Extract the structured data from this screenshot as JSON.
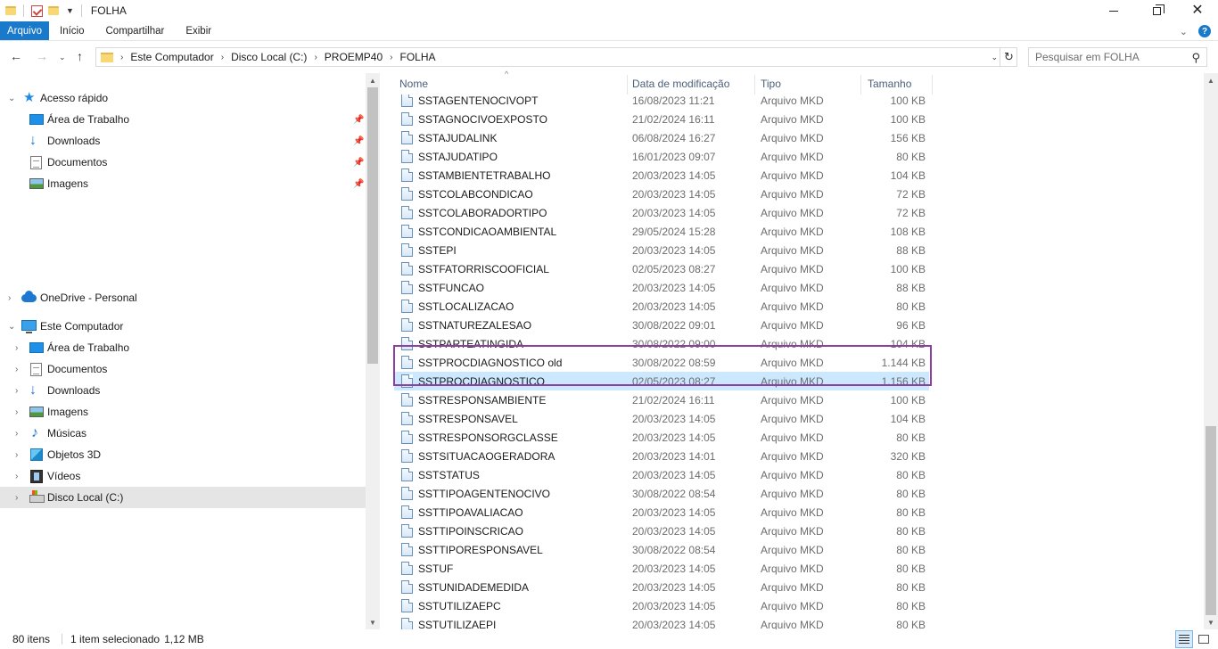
{
  "window": {
    "title": "FOLHA"
  },
  "ribbon": {
    "tabs": [
      "Arquivo",
      "Início",
      "Compartilhar",
      "Exibir"
    ]
  },
  "address": {
    "crumbs": [
      "Este Computador",
      "Disco Local (C:)",
      "PROEMP40",
      "FOLHA"
    ]
  },
  "search": {
    "placeholder": "Pesquisar em FOLHA"
  },
  "nav": {
    "quick_access": "Acesso rápido",
    "quick_items": [
      "Área de Trabalho",
      "Downloads",
      "Documentos",
      "Imagens"
    ],
    "onedrive": "OneDrive - Personal",
    "this_pc": "Este Computador",
    "pc_items": [
      "Área de Trabalho",
      "Documentos",
      "Downloads",
      "Imagens",
      "Músicas",
      "Objetos 3D",
      "Vídeos",
      "Disco Local (C:)"
    ]
  },
  "columns": {
    "name": "Nome",
    "date": "Data de modificação",
    "type": "Tipo",
    "size": "Tamanho"
  },
  "files": [
    {
      "name": "SSTAGENTENOCIVOPT",
      "date": "16/08/2023 11:21",
      "type": "Arquivo MKD",
      "size": "100 KB"
    },
    {
      "name": "SSTAGNOCIVOEXPOSTO",
      "date": "21/02/2024 16:11",
      "type": "Arquivo MKD",
      "size": "100 KB"
    },
    {
      "name": "SSTAJUDALINK",
      "date": "06/08/2024 16:27",
      "type": "Arquivo MKD",
      "size": "156 KB"
    },
    {
      "name": "SSTAJUDATIPO",
      "date": "16/01/2023 09:07",
      "type": "Arquivo MKD",
      "size": "80 KB"
    },
    {
      "name": "SSTAMBIENTETRABALHO",
      "date": "20/03/2023 14:05",
      "type": "Arquivo MKD",
      "size": "104 KB"
    },
    {
      "name": "SSTCOLABCONDICAO",
      "date": "20/03/2023 14:05",
      "type": "Arquivo MKD",
      "size": "72 KB"
    },
    {
      "name": "SSTCOLABORADORTIPO",
      "date": "20/03/2023 14:05",
      "type": "Arquivo MKD",
      "size": "72 KB"
    },
    {
      "name": "SSTCONDICAOAMBIENTAL",
      "date": "29/05/2024 15:28",
      "type": "Arquivo MKD",
      "size": "108 KB"
    },
    {
      "name": "SSTEPI",
      "date": "20/03/2023 14:05",
      "type": "Arquivo MKD",
      "size": "88 KB"
    },
    {
      "name": "SSTFATORRISCOOFICIAL",
      "date": "02/05/2023 08:27",
      "type": "Arquivo MKD",
      "size": "100 KB"
    },
    {
      "name": "SSTFUNCAO",
      "date": "20/03/2023 14:05",
      "type": "Arquivo MKD",
      "size": "88 KB"
    },
    {
      "name": "SSTLOCALIZACAO",
      "date": "20/03/2023 14:05",
      "type": "Arquivo MKD",
      "size": "80 KB"
    },
    {
      "name": "SSTNATUREZALESAO",
      "date": "30/08/2022 09:01",
      "type": "Arquivo MKD",
      "size": "96 KB"
    },
    {
      "name": "SSTPARTEATINGIDA",
      "date": "30/08/2022 09:00",
      "type": "Arquivo MKD",
      "size": "104 KB"
    },
    {
      "name": "SSTPROCDIAGNOSTICO old",
      "date": "30/08/2022 08:59",
      "type": "Arquivo MKD",
      "size": "1.144 KB"
    },
    {
      "name": "SSTPROCDIAGNOSTICO",
      "date": "02/05/2023 08:27",
      "type": "Arquivo MKD",
      "size": "1.156 KB",
      "selected": true
    },
    {
      "name": "SSTRESPONSAMBIENTE",
      "date": "21/02/2024 16:11",
      "type": "Arquivo MKD",
      "size": "100 KB"
    },
    {
      "name": "SSTRESPONSAVEL",
      "date": "20/03/2023 14:05",
      "type": "Arquivo MKD",
      "size": "104 KB"
    },
    {
      "name": "SSTRESPONSORGCLASSE",
      "date": "20/03/2023 14:05",
      "type": "Arquivo MKD",
      "size": "80 KB"
    },
    {
      "name": "SSTSITUACAOGERADORA",
      "date": "20/03/2023 14:01",
      "type": "Arquivo MKD",
      "size": "320 KB"
    },
    {
      "name": "SSTSTATUS",
      "date": "20/03/2023 14:05",
      "type": "Arquivo MKD",
      "size": "80 KB"
    },
    {
      "name": "SSTTIPOAGENTENOCIVO",
      "date": "30/08/2022 08:54",
      "type": "Arquivo MKD",
      "size": "80 KB"
    },
    {
      "name": "SSTTIPOAVALIACAO",
      "date": "20/03/2023 14:05",
      "type": "Arquivo MKD",
      "size": "80 KB"
    },
    {
      "name": "SSTTIPOINSCRICAO",
      "date": "20/03/2023 14:05",
      "type": "Arquivo MKD",
      "size": "80 KB"
    },
    {
      "name": "SSTTIPORESPONSAVEL",
      "date": "30/08/2022 08:54",
      "type": "Arquivo MKD",
      "size": "80 KB"
    },
    {
      "name": "SSTUF",
      "date": "20/03/2023 14:05",
      "type": "Arquivo MKD",
      "size": "80 KB"
    },
    {
      "name": "SSTUNIDADEMEDIDA",
      "date": "20/03/2023 14:05",
      "type": "Arquivo MKD",
      "size": "80 KB"
    },
    {
      "name": "SSTUTILIZAEPC",
      "date": "20/03/2023 14:05",
      "type": "Arquivo MKD",
      "size": "80 KB"
    },
    {
      "name": "SSTUTILIZAEPI",
      "date": "20/03/2023 14:05",
      "type": "Arquivo MKD",
      "size": "80 KB"
    }
  ],
  "status": {
    "count": "80 itens",
    "selection": "1 item selecionado",
    "size": "1,12 MB"
  },
  "colors": {
    "accent": "#1979ca",
    "selection": "#cce8ff",
    "highlight_border": "#8c3fa0"
  }
}
